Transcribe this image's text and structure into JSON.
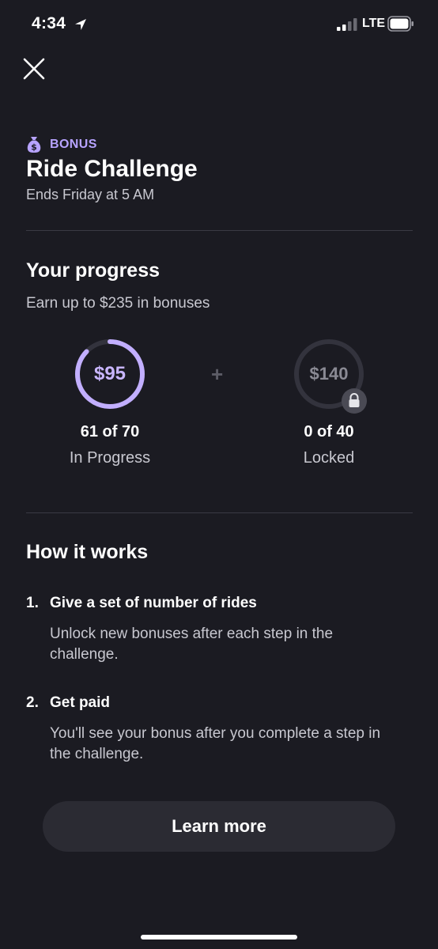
{
  "status_bar": {
    "time": "4:34",
    "network": "LTE"
  },
  "header": {
    "tag": "BONUS",
    "title": "Ride Challenge",
    "subtitle": "Ends Friday at 5 AM"
  },
  "progress": {
    "title": "Your progress",
    "subtitle": "Earn up to $235 in bonuses",
    "separator": "+",
    "tiers": [
      {
        "amount": "$95",
        "count": "61 of 70",
        "state": "In Progress",
        "completed": 61,
        "target": 70,
        "fraction": 0.871
      },
      {
        "amount": "$140",
        "count": "0 of 40",
        "state": "Locked",
        "completed": 0,
        "target": 40,
        "fraction": 0
      }
    ]
  },
  "how_it_works": {
    "title": "How it works",
    "steps": [
      {
        "number": "1.",
        "title": "Give a set of number of rides",
        "description": "Unlock new bonuses after each step in the challenge."
      },
      {
        "number": "2.",
        "title": "Get paid",
        "description": "You'll see your bonus after you complete a step in the challenge."
      }
    ]
  },
  "actions": {
    "learn_more_label": "Learn more"
  },
  "colors": {
    "background": "#1b1b22",
    "accent": "#b7a3ff",
    "ring_track": "#33333d",
    "button": "#2b2b33"
  },
  "icons": {
    "close": "close-icon",
    "bonus": "money-bag-icon",
    "lock": "lock-icon",
    "location": "location-arrow-icon"
  }
}
